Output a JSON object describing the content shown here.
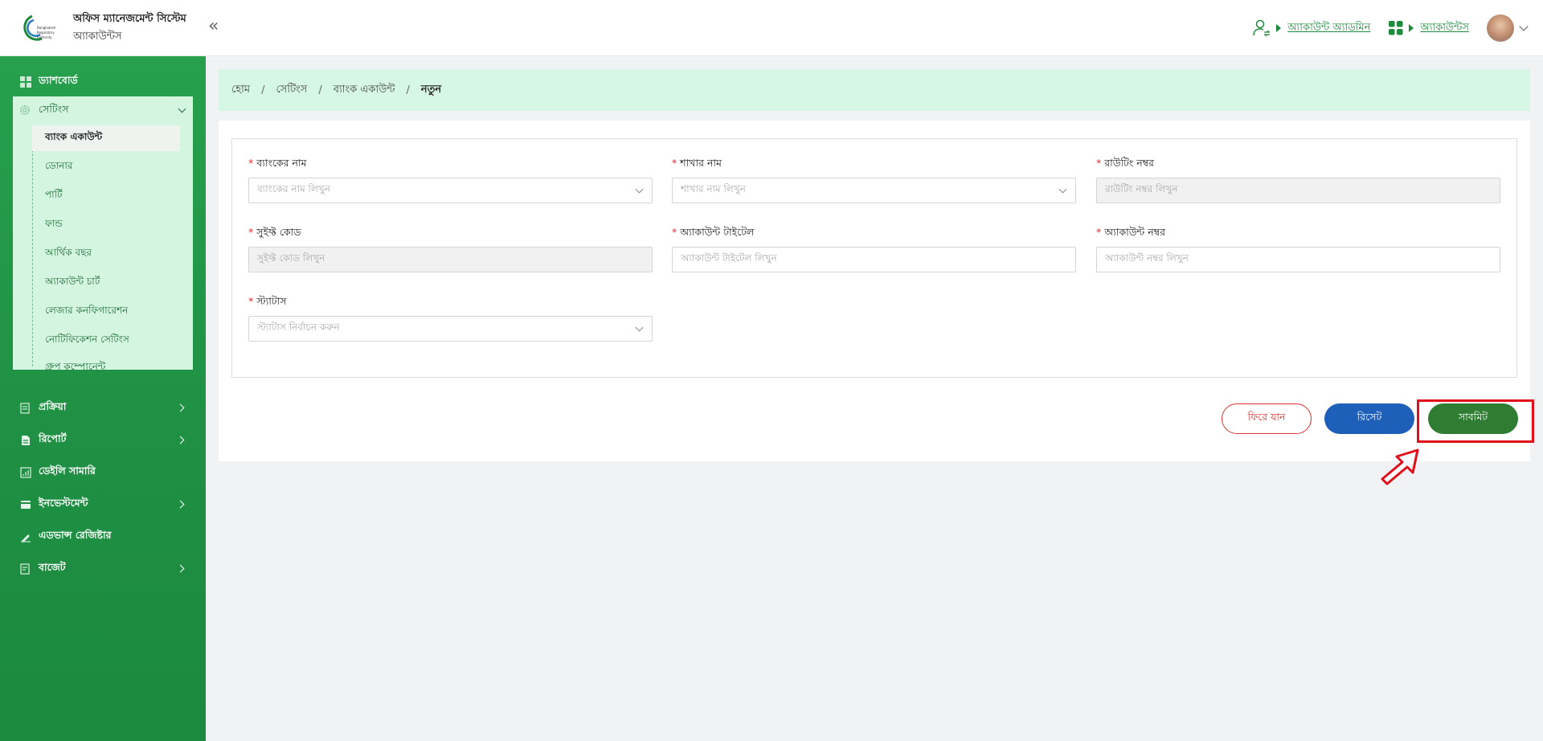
{
  "header": {
    "title": "অফিস ম্যানেজমেন্ট সিস্টেম",
    "subtitle": "অ্যাকাউন্টস",
    "logo_text": [
      "Bangladesh",
      "Regulatory",
      "Authority"
    ],
    "admin_link": "অ্যাকাউন্ট অ্যাডমিন",
    "module_link": "অ্যাকাউন্টস",
    "accent": "#1e8a3e"
  },
  "sidebar": {
    "items": [
      {
        "label": "ড্যাশবোর্ড",
        "icon": "dashboard-icon"
      },
      {
        "label": "প্রক্রিয়া",
        "icon": "process-icon"
      },
      {
        "label": "রিপোর্ট",
        "icon": "report-icon"
      },
      {
        "label": "ডেইলি সামারি",
        "icon": "summary-icon"
      },
      {
        "label": "ইনভেস্টমেন্ট",
        "icon": "investment-icon"
      },
      {
        "label": "এডভান্স রেজিষ্টার",
        "icon": "register-icon"
      },
      {
        "label": "বাজেট",
        "icon": "budget-icon"
      }
    ],
    "settings": {
      "label": "সেটিংস",
      "children": [
        "ব্যাংক একাউন্ট",
        "ডোনার",
        "পার্টি",
        "ফান্ড",
        "আর্থিক বছর",
        "অ্যাকাউন্ট চার্ট",
        "লেজার কনফিগারেশন",
        "নোটিফিকেশন সেটিংস",
        "গ্রুপ কম্পোনেন্ট"
      ]
    }
  },
  "breadcrumb": {
    "home": "হোম",
    "settings": "সেটিংস",
    "bank_account": "ব্যাংক একাউন্ট",
    "current": "নতুন"
  },
  "form": {
    "bank_name": {
      "label": "ব্যাংকের নাম",
      "placeholder": "ব্যাংকের নাম লিখুন"
    },
    "branch_name": {
      "label": "শাখার নাম",
      "placeholder": "শাখার নাম লিখুন"
    },
    "routing_no": {
      "label": "রাউটিং নম্বর",
      "placeholder": "রাউটিং নম্বর লিখুন"
    },
    "swift_code": {
      "label": "সুইফ্ট কোড",
      "placeholder": "সুইফ্ট কোড লিখুন"
    },
    "account_title": {
      "label": "অ্যাকাউন্ট টাইটেল",
      "placeholder": "অ্যাকাউন্ট টাইটেল লিখুন"
    },
    "account_no": {
      "label": "অ্যাকাউন্ট নম্বর",
      "placeholder": "অ্যাকাউন্ট নম্বর লিখুন"
    },
    "status": {
      "label": "স্ট্যাটাস",
      "placeholder": "স্ট্যাটাস নির্বাচন করুন"
    }
  },
  "buttons": {
    "back": "ফিরে যান",
    "reset": "রিসেট",
    "submit": "সাবমিট"
  }
}
